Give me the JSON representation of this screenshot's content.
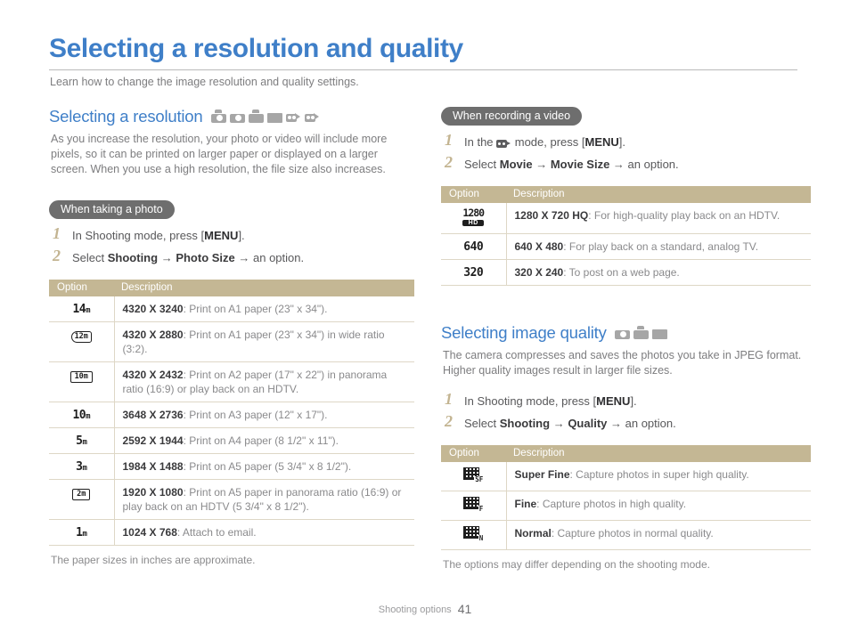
{
  "page": {
    "title": "Selecting a resolution and quality",
    "subtitle": "Learn how to change the image resolution and quality settings.",
    "footer_label": "Shooting options",
    "footer_page": "41",
    "accent_blue": "#3f7fc8",
    "table_header_tan": "#c4b794",
    "pill_gray": "#6e6e6e",
    "step_number_color": "#c3b491"
  },
  "sections": {
    "resolution": {
      "heading": "Selecting a resolution",
      "mode_icons": [
        "smart-auto-camera-icon",
        "program-camera-icon",
        "dual-is-camera-icon",
        "scene-camera-icon",
        "movie-camera-icon",
        "smart-movie-camera-icon"
      ],
      "intro": "As you increase the resolution, your photo or video will include more pixels, so it can be printed on larger paper or displayed on a larger screen. When you use a high resolution, the file size also increases.",
      "photo_badge": "When taking a photo",
      "steps": [
        {
          "num": "1",
          "pre": "In Shooting mode, press [",
          "key": "MENU",
          "post": "]."
        },
        {
          "num": "2",
          "pre": "Select ",
          "bold1": "Shooting",
          "arrow1": " → ",
          "bold2": "Photo Size",
          "arrow2": " → ",
          "post": "an option."
        }
      ],
      "table": {
        "col_option": "Option",
        "col_description": "Description",
        "rows": [
          {
            "icon": "14m",
            "icon_style": "plain",
            "lead": "4320 X 3240",
            "desc": ": Print on A1 paper (23\" x 34\")."
          },
          {
            "icon": "12m",
            "icon_style": "curve",
            "lead": "4320 X 2880",
            "desc": ": Print on A1 paper (23\" x 34\") in wide ratio (3:2)."
          },
          {
            "icon": "10m",
            "icon_style": "wide",
            "lead": "4320 X 2432",
            "desc": ": Print on A2 paper (17\" x 22\") in panorama ratio (16:9) or play back on an HDTV."
          },
          {
            "icon": "10m",
            "icon_style": "plain",
            "lead": "3648 X 2736",
            "desc": ": Print on A3 paper (12\" x 17\")."
          },
          {
            "icon": "5m",
            "icon_style": "plain",
            "lead": "2592 X 1944",
            "desc": ": Print on A4 paper (8 1/2\" x 11\")."
          },
          {
            "icon": "3m",
            "icon_style": "plain",
            "lead": "1984 X 1488",
            "desc": ": Print on A5 paper (5 3/4\" x 8 1/2\")."
          },
          {
            "icon": "2m",
            "icon_style": "wide",
            "lead": "1920 X 1080",
            "desc": ": Print on A5 paper in panorama ratio (16:9) or play back on an HDTV (5 3/4\" x 8 1/2\")."
          },
          {
            "icon": "1m",
            "icon_style": "plain",
            "lead": "1024 X 768",
            "desc": ": Attach to email."
          }
        ],
        "note": "The paper sizes in inches are approximate."
      }
    },
    "video": {
      "badge": "When recording a video",
      "steps": [
        {
          "num": "1",
          "pre": "In the ",
          "icon": "movie-mode-icon",
          "mid": " mode, press [",
          "key": "MENU",
          "post": "]."
        },
        {
          "num": "2",
          "pre": "Select ",
          "bold1": "Movie",
          "arrow1": " → ",
          "bold2": "Movie Size",
          "arrow2": " → ",
          "post": "an option."
        }
      ],
      "table": {
        "col_option": "Option",
        "col_description": "Description",
        "rows": [
          {
            "icon": "1280",
            "badge": "HD",
            "lead": "1280 X 720 HQ",
            "desc": ": For high-quality play back on an HDTV."
          },
          {
            "icon": "640",
            "badge": "",
            "lead": "640 X 480",
            "desc": ": For play back on a standard, analog TV."
          },
          {
            "icon": "320",
            "badge": "",
            "lead": "320 X 240",
            "desc": ": To post on a web page."
          }
        ]
      }
    },
    "quality": {
      "heading": "Selecting image quality",
      "mode_icons": [
        "program-camera-icon",
        "dual-is-camera-icon",
        "scene-camera-icon"
      ],
      "intro": "The camera compresses and saves the photos you take in JPEG format. Higher quality images result in larger file sizes.",
      "steps": [
        {
          "num": "1",
          "pre": "In Shooting mode, press [",
          "key": "MENU",
          "post": "]."
        },
        {
          "num": "2",
          "pre": "Select ",
          "bold1": "Shooting",
          "arrow1": " → ",
          "bold2": "Quality",
          "arrow2": " → ",
          "post": "an option."
        }
      ],
      "table": {
        "col_option": "Option",
        "col_description": "Description",
        "rows": [
          {
            "icon": "SF",
            "lead": "Super Fine",
            "desc": ": Capture photos in super high quality."
          },
          {
            "icon": "F",
            "lead": "Fine",
            "desc": ": Capture photos in high quality."
          },
          {
            "icon": "N",
            "lead": "Normal",
            "desc": ": Capture photos in normal quality."
          }
        ],
        "note": "The options may differ depending on the shooting mode."
      }
    }
  }
}
